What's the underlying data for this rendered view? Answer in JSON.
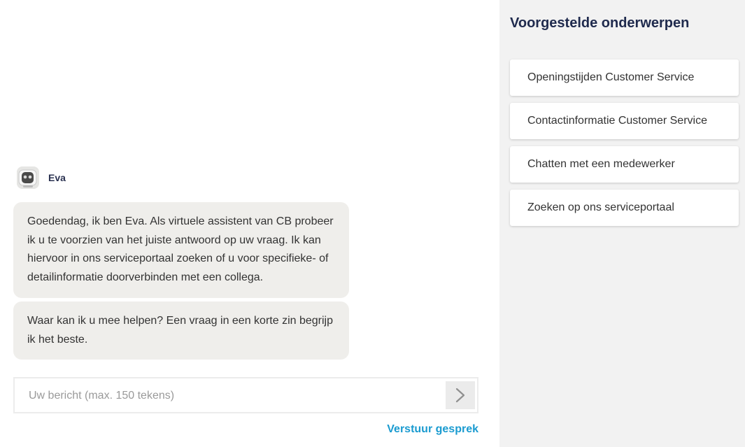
{
  "chat": {
    "bot_name": "Eva",
    "messages": [
      {
        "text": "Goedendag, ik ben Eva. Als virtuele assistent van CB probeer ik u te voorzien van het juiste antwoord op uw vraag. Ik kan hiervoor in ons serviceportaal zoeken of u voor specifieke- of detailinformatie doorverbinden met een collega."
      },
      {
        "text": "Waar kan ik u mee helpen? Een vraag in een korte zin begrijp ik het beste."
      }
    ],
    "input": {
      "placeholder": "Uw bericht (max. 150 tekens)",
      "value": ""
    },
    "send_icon": "chevron-right-icon",
    "end_chat_label": "Verstuur gesprek"
  },
  "suggestions": {
    "title": "Voorgestelde onderwerpen",
    "items": [
      {
        "label": "Openingstijden Customer Service"
      },
      {
        "label": "Contactinformatie Customer Service"
      },
      {
        "label": "Chatten met een medewerker"
      },
      {
        "label": "Zoeken op ons serviceportaal"
      }
    ]
  },
  "colors": {
    "bubble_bg": "#efeeeb",
    "panel_bg": "#f2f2f2",
    "title_color": "#1f2a4d",
    "link_color": "#1a9bd0"
  }
}
